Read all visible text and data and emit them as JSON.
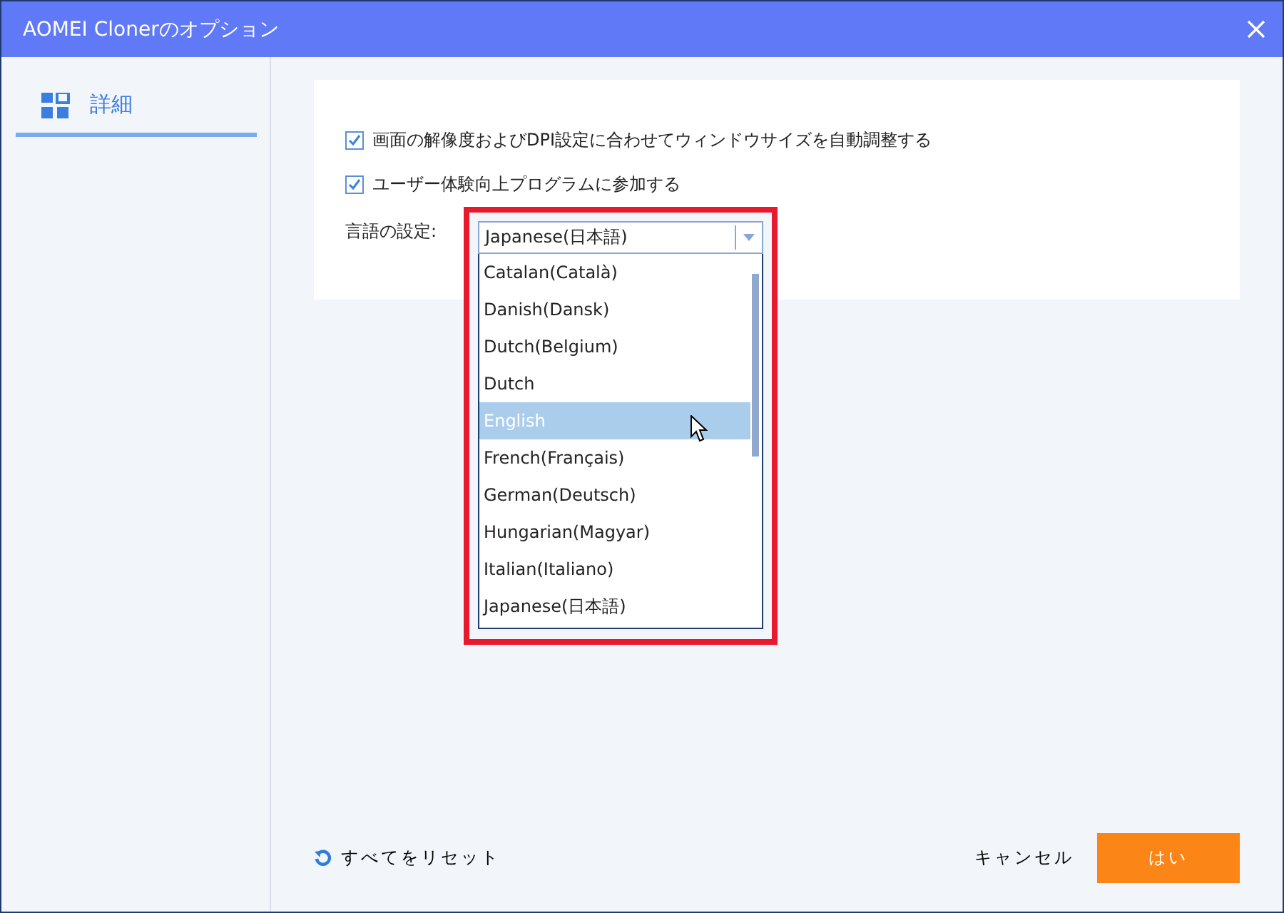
{
  "window": {
    "title": "AOMEI Clonerのオプション"
  },
  "sidebar": {
    "items": [
      {
        "label": "詳細",
        "selected": true
      }
    ]
  },
  "options": [
    {
      "label": "画面の解像度およびDPI設定に合わせてウィンドウサイズを自動調整する",
      "checked": true
    },
    {
      "label": "ユーザー体験向上プログラムに参加する",
      "checked": true
    }
  ],
  "language": {
    "label": "言語の設定:",
    "value": "Japanese(日本語)",
    "expanded": true,
    "options": [
      {
        "label": "Catalan(Català)",
        "highlighted": false
      },
      {
        "label": "Danish(Dansk)",
        "highlighted": false
      },
      {
        "label": "Dutch(Belgium)",
        "highlighted": false
      },
      {
        "label": "Dutch",
        "highlighted": false
      },
      {
        "label": "English",
        "highlighted": true
      },
      {
        "label": "French(Français)",
        "highlighted": false
      },
      {
        "label": "German(Deutsch)",
        "highlighted": false
      },
      {
        "label": "Hungarian(Magyar)",
        "highlighted": false
      },
      {
        "label": "Italian(Italiano)",
        "highlighted": false
      },
      {
        "label": "Japanese(日本語)",
        "highlighted": false
      }
    ]
  },
  "footer": {
    "reset": "すべてをリセット",
    "cancel": "キャンセル",
    "ok": "はい"
  }
}
